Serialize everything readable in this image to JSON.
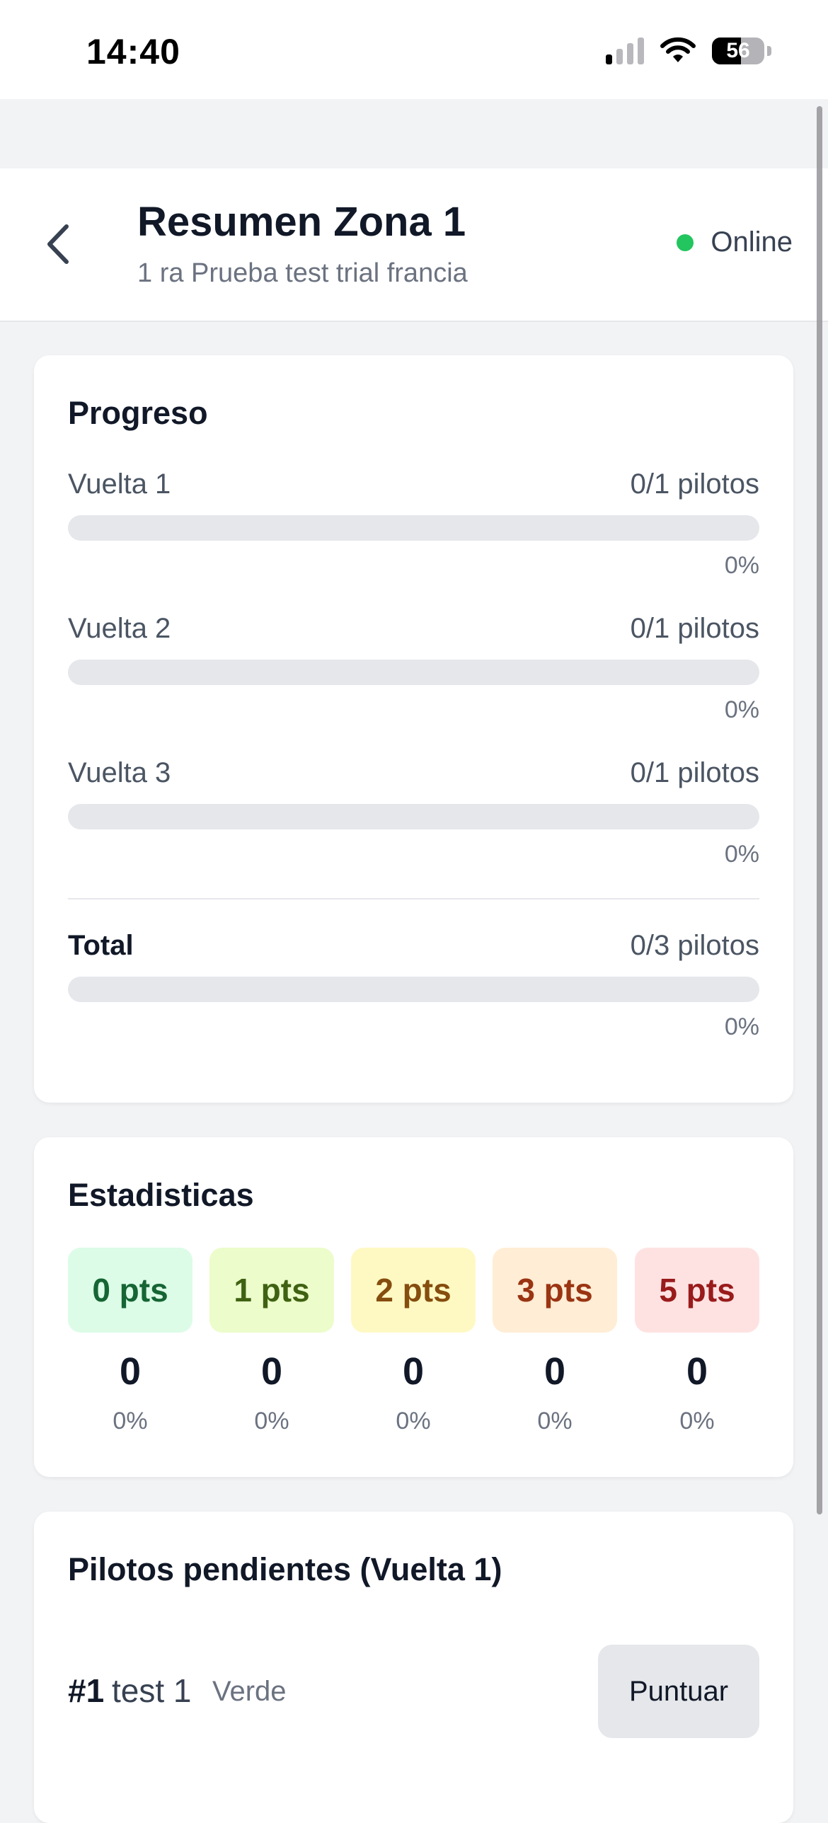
{
  "status_bar": {
    "time": "14:40",
    "battery": "56",
    "battery_level": 0.56
  },
  "header": {
    "back_icon": "chevron-left-icon",
    "title": "Resumen Zona 1",
    "subtitle": "1 ra Prueba test trial francia",
    "connection_status": "Online",
    "connection_color": "#22c55e"
  },
  "progress": {
    "title": "Progreso",
    "laps": [
      {
        "label": "Vuelta 1",
        "count": "0/1 pilotos",
        "percent": "0%",
        "fraction": 0
      },
      {
        "label": "Vuelta 2",
        "count": "0/1 pilotos",
        "percent": "0%",
        "fraction": 0
      },
      {
        "label": "Vuelta 3",
        "count": "0/1 pilotos",
        "percent": "0%",
        "fraction": 0
      }
    ],
    "total": {
      "label": "Total",
      "count": "0/3 pilotos",
      "percent": "0%",
      "fraction": 0
    }
  },
  "stats": {
    "title": "Estadisticas",
    "items": [
      {
        "label": "0 pts",
        "count": "0",
        "percent": "0%",
        "bg": "#dcfce7",
        "fg": "#166534"
      },
      {
        "label": "1 pts",
        "count": "0",
        "percent": "0%",
        "bg": "#ecfccb",
        "fg": "#3f6212"
      },
      {
        "label": "2 pts",
        "count": "0",
        "percent": "0%",
        "bg": "#fef9c3",
        "fg": "#854d0e"
      },
      {
        "label": "3 pts",
        "count": "0",
        "percent": "0%",
        "bg": "#ffedd5",
        "fg": "#9a3412"
      },
      {
        "label": "5 pts",
        "count": "0",
        "percent": "0%",
        "bg": "#fee2e2",
        "fg": "#991b1b"
      }
    ]
  },
  "pending": {
    "title": "Pilotos pendientes (Vuelta 1)",
    "pilots": [
      {
        "number": "#1",
        "name": "test 1",
        "category": "Verde",
        "action": "Puntuar"
      }
    ]
  }
}
